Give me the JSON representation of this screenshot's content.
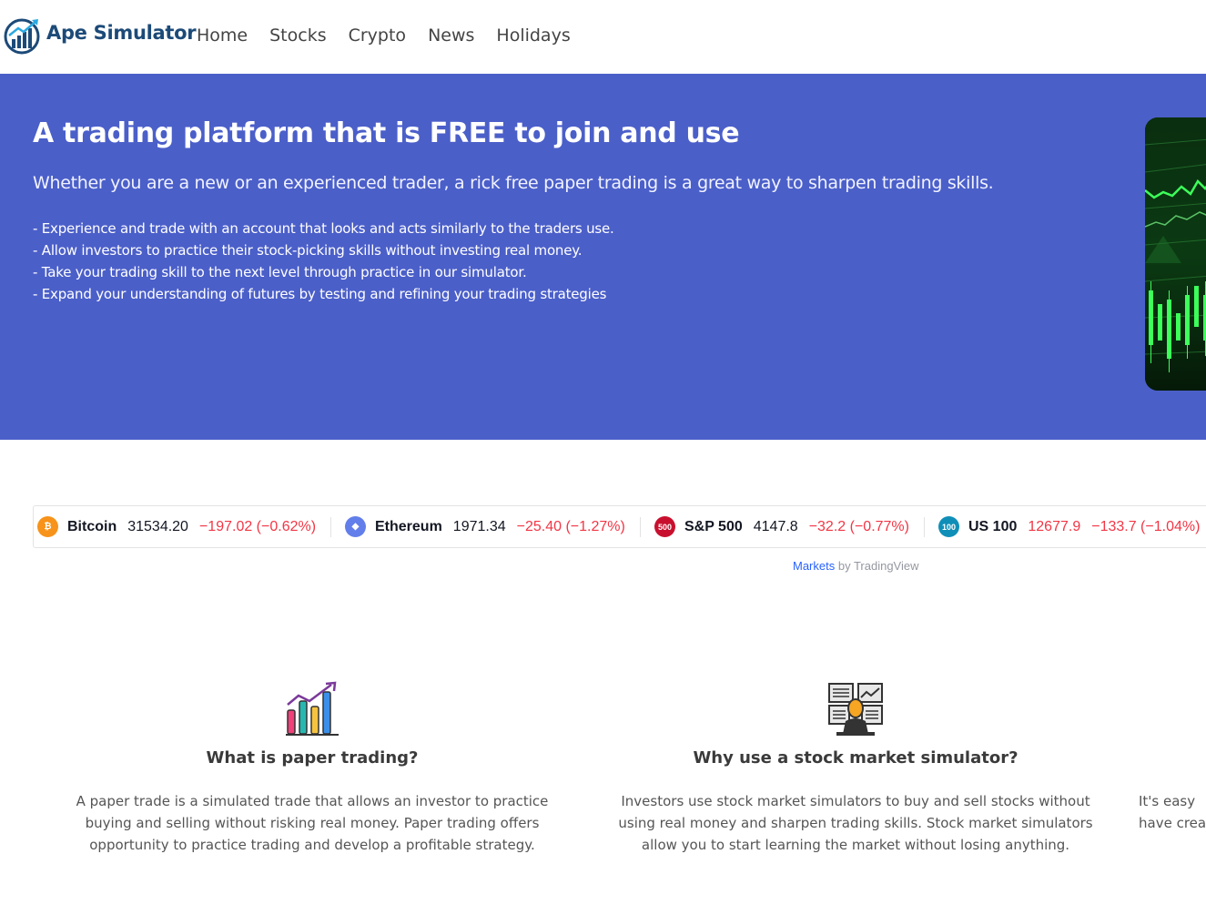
{
  "brand": {
    "name": "Ape Simulator",
    "logo_icon": "rising-chart-logo-icon"
  },
  "nav": {
    "items": [
      "Home",
      "Stocks",
      "Crypto",
      "News",
      "Holidays"
    ]
  },
  "hero": {
    "title": "A trading platform that is FREE to join and use",
    "subtitle": "Whether you are a new or an experienced trader, a rick free paper trading is a great way to sharpen trading skills.",
    "bullets": [
      "- Experience and trade with an account that looks and acts similarly to the traders use.",
      "- Allow investors to practice their stock-picking skills without investing real money.",
      "- Take your trading skill to the next level through practice in our simulator.",
      "- Expand your understanding of futures by testing and refining your trading strategies"
    ],
    "image": "green-candlestick-chart-image"
  },
  "ticker": {
    "items": [
      {
        "name": "Bitcoin",
        "price": "31534.20",
        "change": "−197.02 (−0.62%)",
        "icon_label": "₿",
        "icon_color": "#f7931a"
      },
      {
        "name": "Ethereum",
        "price": "1971.34",
        "change": "−25.40 (−1.27%)",
        "icon_label": "◆",
        "icon_color": "#627eea"
      },
      {
        "name": "S&P 500",
        "price": "4147.8",
        "change": "−32.2 (−0.77%)",
        "icon_label": "500",
        "icon_color": "#c8102e"
      },
      {
        "name": "US 100",
        "price": "12677.9",
        "change": "−133.7 (−1.04%)",
        "icon_label": "100",
        "icon_color": "#0f8fb8"
      }
    ],
    "credit_link": "Markets",
    "credit_text": " by TradingView",
    "negative_color": "#f23645"
  },
  "features": [
    {
      "title": "What is paper trading?",
      "text": "A paper trade is a simulated trade that allows an investor to practice buying and selling without risking real money. Paper trading offers opportunity to practice trading and develop a profitable strategy.",
      "icon": "bar-chart-growth-icon"
    },
    {
      "title": "Why use a stock market simulator?",
      "text": "Investors use stock market simulators to buy and sell stocks without using real money and sharpen trading skills. Stock market simulators allow you to start learning the market without losing anything.",
      "icon": "trader-screens-icon"
    },
    {
      "title": "",
      "text": "It's easy have creat",
      "icon": ""
    }
  ],
  "colors": {
    "hero_bg": "#4b5fc9",
    "brand": "#1c4a78"
  }
}
